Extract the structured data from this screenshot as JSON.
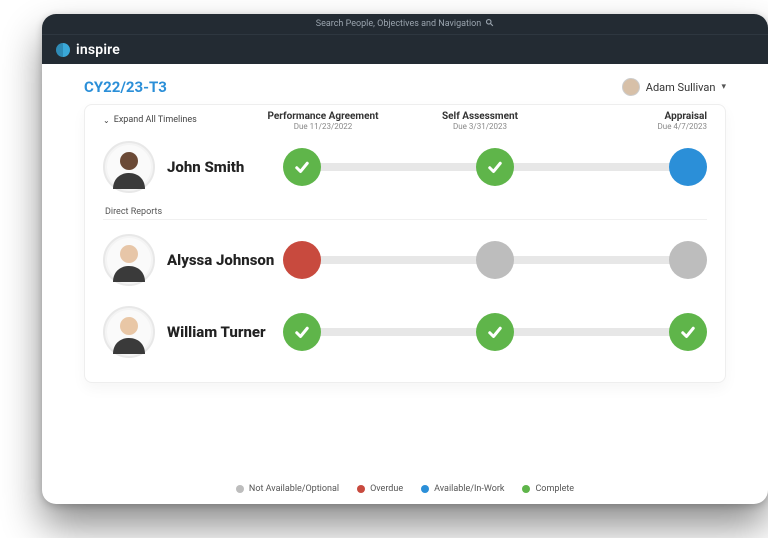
{
  "search_placeholder": "Search People, Objectives and Navigation",
  "brand": "inspire",
  "period": "CY22/23-T3",
  "current_user": "Adam Sullivan",
  "expand_label": "Expand All Timelines",
  "direct_reports_label": "Direct Reports",
  "stages": [
    {
      "title": "Performance Agreement",
      "due": "Due 11/23/2022"
    },
    {
      "title": "Self Assessment",
      "due": "Due 3/31/2023"
    },
    {
      "title": "Appraisal",
      "due": "Due 4/7/2023"
    }
  ],
  "people": [
    {
      "name": "John Smith",
      "skin": "#6b4a36",
      "statuses": [
        "complete",
        "complete",
        "inwork"
      ]
    },
    {
      "name": "Alyssa Johnson",
      "skin": "#e7c6a8",
      "statuses": [
        "overdue",
        "na",
        "na"
      ]
    },
    {
      "name": "William Turner",
      "skin": "#e9c7a6",
      "statuses": [
        "complete",
        "complete",
        "complete"
      ]
    }
  ],
  "legend": [
    {
      "cls": "na",
      "label": "Not Available/Optional"
    },
    {
      "cls": "overdue",
      "label": "Overdue"
    },
    {
      "cls": "inwork",
      "label": "Available/In-Work"
    },
    {
      "cls": "complete",
      "label": "Complete"
    }
  ]
}
